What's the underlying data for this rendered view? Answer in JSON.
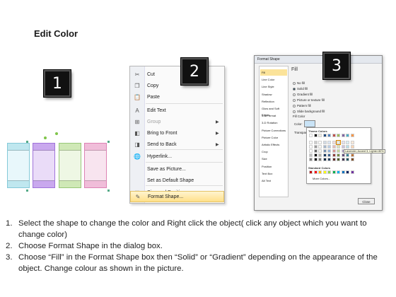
{
  "title": "Edit Color",
  "steps": {
    "one": "1",
    "two": "2",
    "three": "3"
  },
  "shapes": [
    {
      "fill": "#e8f7fb",
      "band": "#bfe7ef",
      "edge": "#84c9d8"
    },
    {
      "fill": "#eadcf8",
      "band": "#c9a8ee",
      "edge": "#a073da"
    },
    {
      "fill": "#eef7e4",
      "band": "#cfe8b6",
      "edge": "#98c878"
    },
    {
      "fill": "#f8e4ef",
      "band": "#f0bdd9",
      "edge": "#dd82b4"
    }
  ],
  "context_menu": {
    "items": [
      {
        "label": "Cut",
        "icon": "scissors-icon",
        "glyph": "✂",
        "disabled": false,
        "submenu": false
      },
      {
        "label": "Copy",
        "icon": "copy-icon",
        "glyph": "❐",
        "disabled": false,
        "submenu": false
      },
      {
        "label": "Paste",
        "icon": "paste-icon",
        "glyph": "📋",
        "disabled": false,
        "submenu": false
      },
      {
        "label": "Edit Text",
        "icon": "edit-text-icon",
        "glyph": "A",
        "disabled": false,
        "submenu": false
      },
      {
        "label": "Group",
        "icon": "group-icon",
        "glyph": "⊞",
        "disabled": true,
        "submenu": true
      },
      {
        "label": "Bring to Front",
        "icon": "bring-to-front-icon",
        "glyph": "◧",
        "disabled": false,
        "submenu": true
      },
      {
        "label": "Send to Back",
        "icon": "send-to-back-icon",
        "glyph": "◨",
        "disabled": false,
        "submenu": true
      },
      {
        "label": "Hyperlink...",
        "icon": "hyperlink-icon",
        "glyph": "🌐",
        "disabled": false,
        "submenu": false
      },
      {
        "label": "Save as Picture...",
        "icon": "",
        "glyph": "",
        "disabled": false,
        "submenu": false
      },
      {
        "label": "Set as Default Shape",
        "icon": "",
        "glyph": "",
        "disabled": false,
        "submenu": false
      },
      {
        "label": "Size and Position...",
        "icon": "size-position-icon",
        "glyph": "▦",
        "disabled": false,
        "submenu": false
      },
      {
        "label": "Format Shape...",
        "icon": "format-shape-icon",
        "glyph": "✎",
        "disabled": false,
        "submenu": false,
        "hover": true
      }
    ]
  },
  "dialog": {
    "title": "Format Shape",
    "nav": [
      "Fill",
      "Line Color",
      "Line Style",
      "Shadow",
      "Reflection",
      "Glow and Soft Edges",
      "3-D Format",
      "3-D Rotation",
      "Picture Corrections",
      "Picture Color",
      "Artistic Effects",
      "Crop",
      "Size",
      "Position",
      "Text Box",
      "Alt Text"
    ],
    "heading": "Fill",
    "options": [
      "No fill",
      "Solid fill",
      "Gradient fill",
      "Picture or texture fill",
      "Pattern fill",
      "Slide background fill"
    ],
    "selected_option": "Solid fill",
    "fill_color_label": "Fill Color",
    "color_label": "Color:",
    "transparency_label": "Transparency:",
    "palette": {
      "theme_label": "Theme Colors",
      "standard_label": "Standard Colors",
      "more_label": "More Colors...",
      "tooltip": "Lavender, Accent 3, Lighter 80%",
      "theme_colors": [
        "#ffffff",
        "#000000",
        "#eeece1",
        "#1f497d",
        "#4f81bd",
        "#c0504d",
        "#9bbb59",
        "#8064a2",
        "#4bacc6",
        "#f79646"
      ],
      "standard_colors": [
        "#c00000",
        "#ff0000",
        "#ffc000",
        "#ffff00",
        "#92d050",
        "#00b050",
        "#00b0f0",
        "#0070c0",
        "#002060",
        "#7030a0"
      ]
    },
    "close_label": "Close"
  },
  "instructions": [
    {
      "num": "1.",
      "text": "Select the shape to change the color and Right click the object( click any object which you want to change color)"
    },
    {
      "num": "2.",
      "text": "Choose Format Shape in the dialog box."
    },
    {
      "num": "3.",
      "text": "Choose “Fill” in the Format Shape box then “Solid” or “Gradient” depending on the appearance of the object. Change colour as shown in the picture."
    }
  ]
}
